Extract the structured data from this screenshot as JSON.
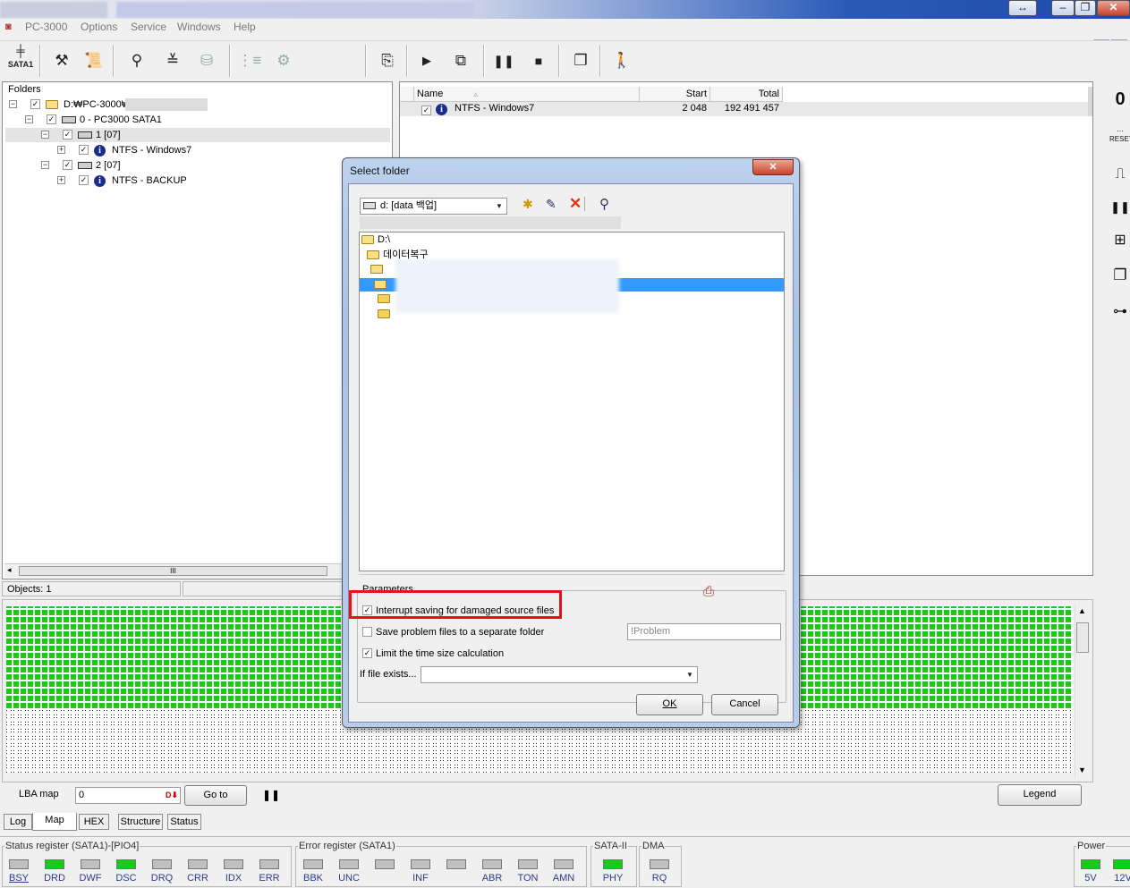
{
  "app": {
    "title": "PC-3000",
    "window_controls": [
      "↔",
      "–",
      "❐",
      "✕"
    ]
  },
  "menu": {
    "items": [
      "PC-3000",
      "Options",
      "Service",
      "Windows",
      "Help"
    ]
  },
  "toolbar": {
    "sata_label": "SATA1"
  },
  "folders": {
    "title": "Folders",
    "tree": [
      {
        "label": "D:₩PC-3000₩",
        "indent": 0,
        "toggle": "-",
        "selected": false
      },
      {
        "label": "0 - PC3000 SATA1",
        "indent": 1,
        "toggle": "-",
        "selected": false
      },
      {
        "label": "1 [07]",
        "indent": 2,
        "toggle": "-",
        "selected": true
      },
      {
        "label": "NTFS - Windows7",
        "indent": 3,
        "toggle": "+",
        "selected": false
      },
      {
        "label": "2 [07]",
        "indent": 2,
        "toggle": "-",
        "selected": false
      },
      {
        "label": "NTFS - BACKUP",
        "indent": 3,
        "toggle": "+",
        "selected": false
      }
    ],
    "objects_label": "Objects: 1"
  },
  "file_list": {
    "columns": [
      "Name",
      "Start",
      "Total"
    ],
    "rows": [
      {
        "name": "NTFS - Windows7",
        "start": "2 048",
        "total": "192 491 457"
      }
    ]
  },
  "dialog": {
    "title": "Select folder",
    "drive_value": "d: [data 백업]",
    "folders": [
      {
        "label": "D:\\",
        "open": true
      },
      {
        "label": "데이터복구",
        "open": true
      },
      {
        "label": "",
        "open": true
      },
      {
        "label": "",
        "open": true,
        "selected": true
      },
      {
        "label": "",
        "open": false
      },
      {
        "label": "",
        "open": false
      }
    ],
    "parameters_title": "Parameters",
    "options": [
      {
        "label": "Interrupt saving for damaged source files",
        "checked": true
      },
      {
        "label": "Save problem files to a separate folder",
        "checked": false
      },
      {
        "label": "Limit the time size calculation",
        "checked": true
      }
    ],
    "problem_folder_placeholder": "!Problem",
    "if_exists_label": "If file exists...",
    "if_exists_value": "",
    "ok_label": "OK",
    "cancel_label": "Cancel"
  },
  "map": {
    "lba_label": "LBA map",
    "lba_value": "0",
    "goto_label": "Go to",
    "legend_label": "Legend",
    "filled_fraction": 0.62,
    "tabs": [
      "Log",
      "Map",
      "HEX",
      "Structure",
      "Status"
    ],
    "active_tab": "Map"
  },
  "status": {
    "status_register": {
      "title": "Status register (SATA1)-[PIO4]",
      "leds": [
        {
          "name": "BSY",
          "on": false
        },
        {
          "name": "DRD",
          "on": true
        },
        {
          "name": "DWF",
          "on": false
        },
        {
          "name": "DSC",
          "on": true
        },
        {
          "name": "DRQ",
          "on": false
        },
        {
          "name": "CRR",
          "on": false
        },
        {
          "name": "IDX",
          "on": false
        },
        {
          "name": "ERR",
          "on": false
        }
      ]
    },
    "error_register": {
      "title": "Error register (SATA1)",
      "leds": [
        {
          "name": "BBK",
          "on": false
        },
        {
          "name": "UNC",
          "on": false
        },
        {
          "name": "",
          "on": false
        },
        {
          "name": "INF",
          "on": false
        },
        {
          "name": "",
          "on": false
        },
        {
          "name": "ABR",
          "on": false
        },
        {
          "name": "TON",
          "on": false
        },
        {
          "name": "AMN",
          "on": false
        }
      ]
    },
    "sata": {
      "title": "SATA-II",
      "leds": [
        {
          "name": "PHY",
          "on": true
        }
      ]
    },
    "dma": {
      "title": "DMA",
      "leds": [
        {
          "name": "RQ",
          "on": false
        }
      ]
    },
    "power": {
      "title": "Power",
      "leds": [
        {
          "name": "5V",
          "on": true
        },
        {
          "name": "12V",
          "on": true
        }
      ]
    }
  },
  "colors": {
    "led_on": "#10d010",
    "selection": "#3399ff",
    "highlight_box": "#e8111a",
    "map_filled": "#10d010"
  }
}
